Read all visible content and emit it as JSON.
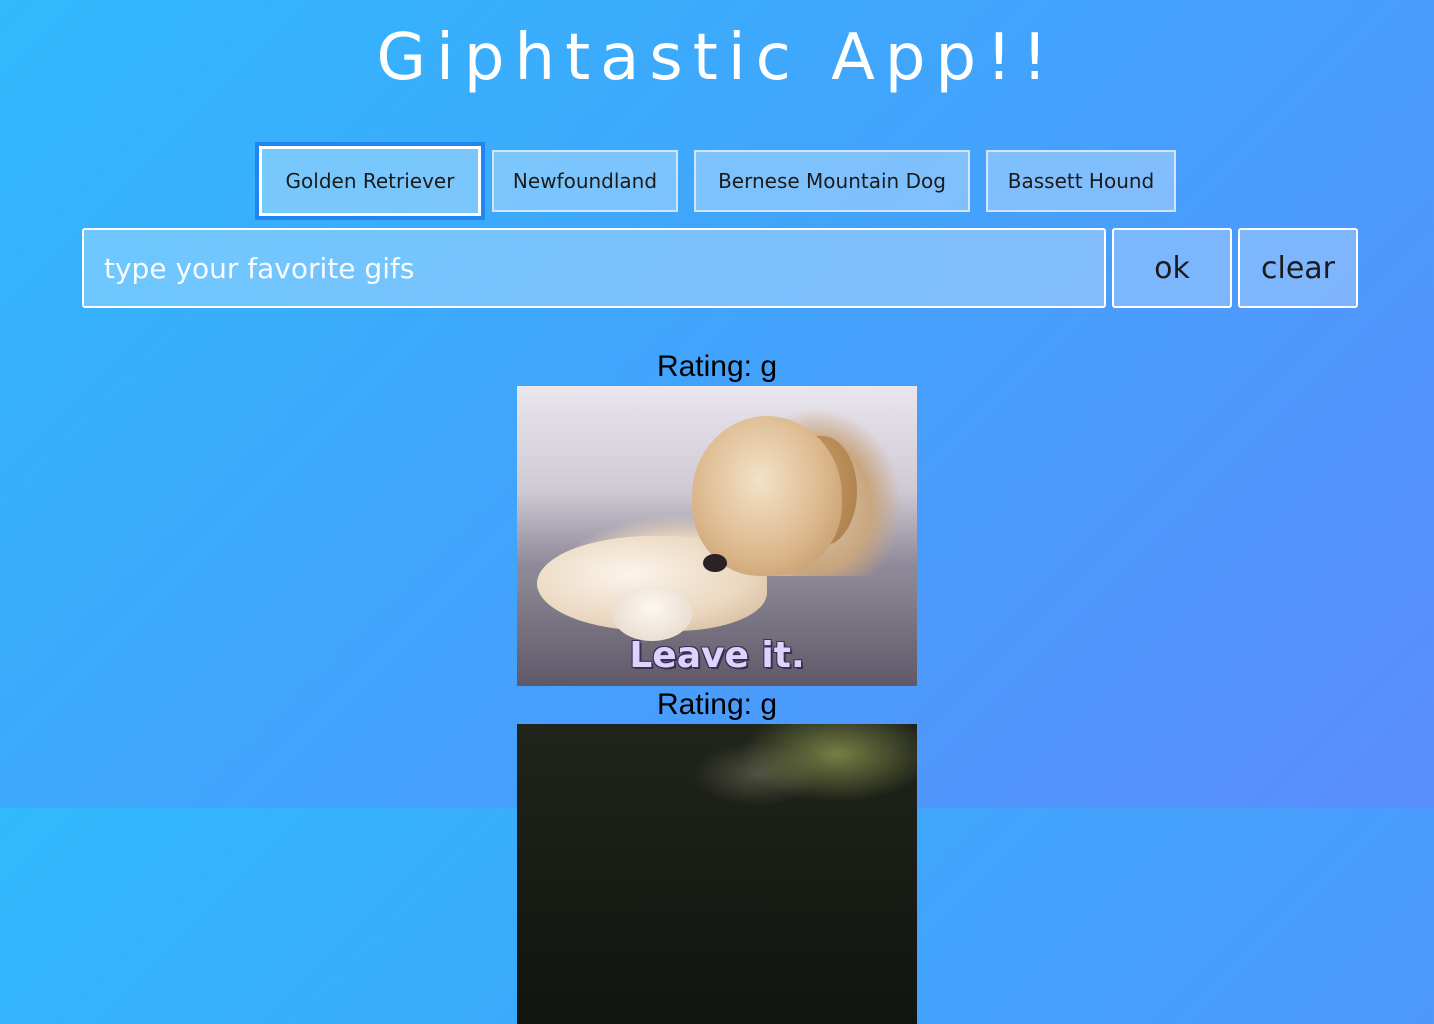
{
  "app": {
    "title": "Giphtastic App!!"
  },
  "topics": [
    {
      "label": "Golden Retriever",
      "focused": true
    },
    {
      "label": "Newfoundland",
      "focused": false
    },
    {
      "label": "Bernese Mountain Dog",
      "focused": false
    },
    {
      "label": "Bassett Hound",
      "focused": false
    }
  ],
  "search": {
    "value": "",
    "placeholder": "type your favorite gifs",
    "ok_label": "ok",
    "clear_label": "clear"
  },
  "results": [
    {
      "rating_label": "Rating: g",
      "caption": "Leave it."
    },
    {
      "rating_label": "Rating: g",
      "caption": ""
    }
  ],
  "colors": {
    "background_start": "#30b9fd",
    "background_end": "#5b8dfd",
    "focus_ring": "#1f86f4",
    "text_dark": "#1b1b1b",
    "title_text": "#ffffff"
  }
}
